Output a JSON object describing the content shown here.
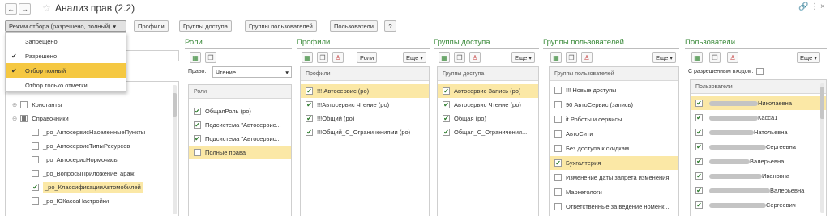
{
  "window": {
    "title": "Анализ прав (2.2)",
    "back_icon": "←",
    "forward_icon": "→",
    "star_icon": "☆",
    "link_icon": "🔗",
    "menu_icon": "⋮",
    "close_icon": "×"
  },
  "toolbar": {
    "mode_selector": "Режим отбора (разрешено, полный)",
    "dropdown_arrow": "▾",
    "profiles": "Профили",
    "access_groups": "Группы доступа",
    "user_groups": "Группы пользователей",
    "users": "Пользователи",
    "help": "?"
  },
  "mode_menu": {
    "items": [
      {
        "label": "Запрещено",
        "checked": false,
        "selected": false
      },
      {
        "label": "Разрешено",
        "checked": true,
        "selected": false
      },
      {
        "label": "Отбор полный",
        "checked": true,
        "selected": true
      },
      {
        "label": "Отбор только отметки",
        "checked": false,
        "selected": false
      }
    ]
  },
  "objects_tree": {
    "rows": [
      {
        "label": "Константы",
        "expander": "⊕",
        "state": "unchecked"
      },
      {
        "label": "Справочники",
        "expander": "⊖",
        "state": "mixed"
      },
      {
        "label": "_ро_АвтосервисНаселенныеПункты",
        "state": "unchecked"
      },
      {
        "label": "_ро_АвтосервисТипыРесурсов",
        "state": "unchecked"
      },
      {
        "label": "_ро_АвтосерисНормочасы",
        "state": "unchecked"
      },
      {
        "label": "_ро_ВопросыПриложениеГараж",
        "state": "unchecked"
      },
      {
        "label": "_ро_КлассификацииАвтомобилей",
        "state": "checked"
      },
      {
        "label": "_ро_ЮКассаНастройки",
        "state": "unchecked"
      }
    ]
  },
  "roles_panel": {
    "title": "Роли",
    "right_label": "Право:",
    "right_value": "Чтение",
    "header": "Роли",
    "rows": [
      {
        "label": "ОбщаяРоль (ро)",
        "checked": true,
        "selected": false
      },
      {
        "label": "Подсистема \"Автосервис...",
        "checked": true,
        "selected": false
      },
      {
        "label": "Подсистема \"Автосервис...",
        "checked": true,
        "selected": false
      },
      {
        "label": "Полные права",
        "checked": false,
        "selected": true
      }
    ]
  },
  "profiles_panel": {
    "title": "Профили",
    "roles_button": "Роли",
    "more_button": "Еще",
    "header": "Профили",
    "rows": [
      {
        "label": "!!! Автосервис (ро)",
        "checked": true,
        "selected": true
      },
      {
        "label": "!!!Автосервис Чтение (ро)",
        "checked": true,
        "selected": false
      },
      {
        "label": "!!!Общий (ро)",
        "checked": true,
        "selected": false
      },
      {
        "label": "!!!Общий_С_Ограничениями (ро)",
        "checked": true,
        "selected": false
      }
    ]
  },
  "access_groups_panel": {
    "title": "Группы доступа",
    "more_button": "Еще",
    "header": "Группы доступа",
    "rows": [
      {
        "label": "Автосервис Запись (ро)",
        "checked": true,
        "selected": true
      },
      {
        "label": "Автосервис Чтение (ро)",
        "checked": true,
        "selected": false
      },
      {
        "label": "Общая (ро)",
        "checked": true,
        "selected": false
      },
      {
        "label": "Общая_С_Ограничения...",
        "checked": true,
        "selected": false
      }
    ]
  },
  "user_groups_panel": {
    "title": "Группы пользователей",
    "more_button": "Еще",
    "header": "Группы пользователей",
    "rows": [
      {
        "label": "!!! Новые доступы",
        "checked": false,
        "selected": false
      },
      {
        "label": "90 АвтоСервис (запись)",
        "checked": false,
        "selected": false
      },
      {
        "label": "it Роботы и сервисы",
        "checked": false,
        "selected": false
      },
      {
        "label": "АвтоСити",
        "checked": false,
        "selected": false
      },
      {
        "label": "Без доступа к скидкам",
        "checked": false,
        "selected": false
      },
      {
        "label": "Бухгалтерия",
        "checked": true,
        "selected": true
      },
      {
        "label": "Изменение даты запрета изменения",
        "checked": false,
        "selected": false
      },
      {
        "label": "Маркетологи",
        "checked": false,
        "selected": false
      },
      {
        "label": "Ответственные за ведение номенк...",
        "checked": false,
        "selected": false
      }
    ]
  },
  "users_panel": {
    "title": "Пользователи",
    "more_button": "Еще",
    "login_filter_label": "С разрешенным входом:",
    "header": "Пользователи",
    "rows": [
      {
        "label": "Николаевна",
        "checked": true,
        "selected": true,
        "blur": 60
      },
      {
        "label": "Касса1",
        "checked": true,
        "selected": false,
        "blur": 60
      },
      {
        "label": "Натольевна",
        "checked": true,
        "selected": false,
        "blur": 55
      },
      {
        "label": "Сергеевна",
        "checked": true,
        "selected": false,
        "blur": 70
      },
      {
        "label": "Валерьевна",
        "checked": true,
        "selected": false,
        "blur": 50
      },
      {
        "label": "Ивановна",
        "checked": true,
        "selected": false,
        "blur": 65
      },
      {
        "label": "Валерьевна",
        "checked": true,
        "selected": false,
        "blur": 75
      },
      {
        "label": "Сергеевич",
        "checked": true,
        "selected": false,
        "blur": 70
      }
    ]
  },
  "colors": {
    "accent_green": "#3a8a3a",
    "selected_row": "#fbe8a6",
    "menu_highlight": "#f5c842"
  }
}
